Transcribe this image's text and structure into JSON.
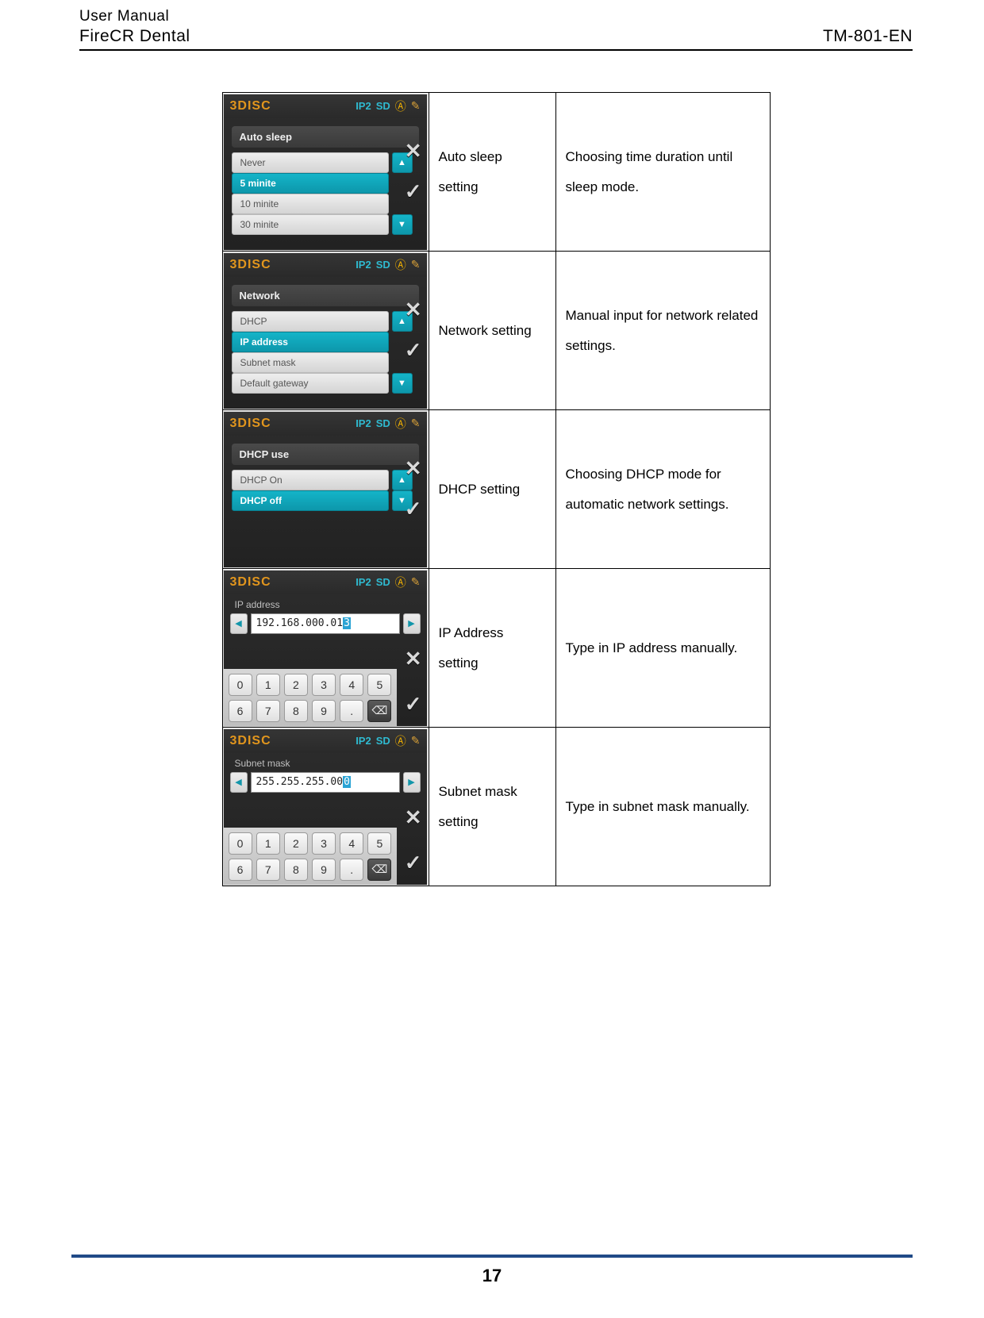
{
  "header": {
    "line1": "User Manual",
    "product": "FireCR Dental",
    "doc_id": "TM-801-EN"
  },
  "device_topbar": {
    "brand": "3DISC",
    "ip_indicator": "IP2",
    "sd_indicator": "SD",
    "auto_icon": "Ⓐ",
    "tool_icon": "✎"
  },
  "rows": [
    {
      "setting": "Auto sleep setting",
      "description": "Choosing time duration until sleep mode.",
      "screen": {
        "type": "list",
        "title": "Auto sleep",
        "options": [
          "Never",
          "5 minite",
          "10 minite",
          "30 minite"
        ],
        "selected_index": 1
      }
    },
    {
      "setting": "Network setting",
      "description": "Manual input for network related settings.",
      "screen": {
        "type": "list",
        "title": "Network",
        "options": [
          "DHCP",
          "IP address",
          "Subnet mask",
          "Default gateway"
        ],
        "selected_index": 1
      }
    },
    {
      "setting": "DHCP setting",
      "description": "Choosing DHCP mode for automatic network settings.",
      "screen": {
        "type": "list",
        "title": "DHCP use",
        "options": [
          "DHCP On",
          "DHCP off"
        ],
        "selected_index": 1
      }
    },
    {
      "setting": "IP Address setting",
      "description": "Type in IP address manually.",
      "screen": {
        "type": "keypad",
        "title": "IP address",
        "value": "192.168.000.01",
        "cursor_char": "3",
        "keys": [
          "0",
          "1",
          "2",
          "3",
          "4",
          "5",
          "6",
          "7",
          "8",
          "9",
          ".",
          "⌫"
        ]
      }
    },
    {
      "setting": "Subnet mask setting",
      "description": "Type in subnet mask manually.",
      "screen": {
        "type": "keypad",
        "title": "Subnet mask",
        "value": "255.255.255.00",
        "cursor_char": "0",
        "keys": [
          "0",
          "1",
          "2",
          "3",
          "4",
          "5",
          "6",
          "7",
          "8",
          "9",
          ".",
          "⌫"
        ]
      }
    }
  ],
  "controls": {
    "cancel_glyph": "✕",
    "confirm_glyph": "✓",
    "up_glyph": "▲",
    "down_glyph": "▼",
    "left_glyph": "◀",
    "right_glyph": "▶"
  },
  "footer": {
    "page_number": "17"
  }
}
